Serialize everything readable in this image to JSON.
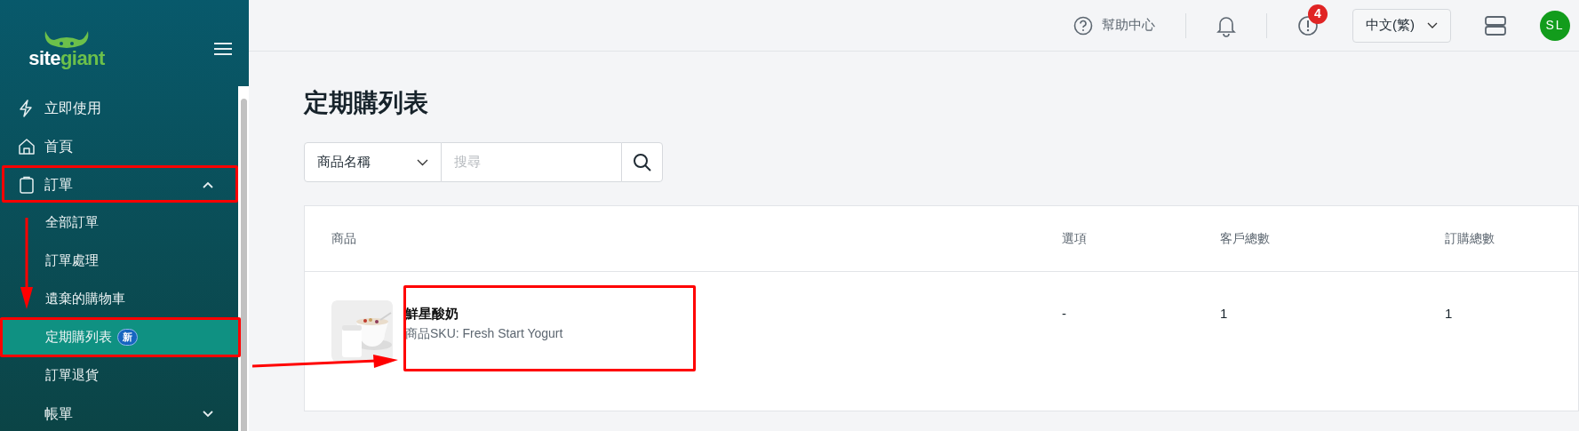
{
  "sidebar": {
    "logo": [
      "site",
      "giant"
    ],
    "items": [
      {
        "label": "立即使用",
        "selected": false
      },
      {
        "label": "首頁",
        "selected": false
      },
      {
        "label": "訂單",
        "selected": false,
        "expanded": true,
        "children": [
          {
            "label": "全部訂單",
            "selected": false
          },
          {
            "label": "訂單處理",
            "selected": false
          },
          {
            "label": "遺棄的購物車",
            "selected": false
          },
          {
            "label": "定期購列表",
            "selected": true,
            "badge": "新"
          },
          {
            "label": "訂單退貨",
            "selected": false
          }
        ]
      },
      {
        "label": "帳單",
        "selected": false,
        "expanded": false
      }
    ]
  },
  "top_bar": {
    "help": "幫助中心",
    "alerts_count": "4",
    "language": "中文(繁)",
    "avatar": "SL"
  },
  "page_title": "定期購列表",
  "search": {
    "field_select": "商品名稱",
    "placeholder": "搜尋"
  },
  "table": {
    "columns": [
      "商品",
      "選項",
      "客戶總數",
      "訂購總數"
    ],
    "rows": [
      {
        "product": {
          "kind": "picture",
          "name": "鮮星酸奶",
          "sku": "商品SKU: Fresh Start Yogurt"
        },
        "option": "-",
        "customers": "1",
        "orders": "1"
      }
    ]
  }
}
